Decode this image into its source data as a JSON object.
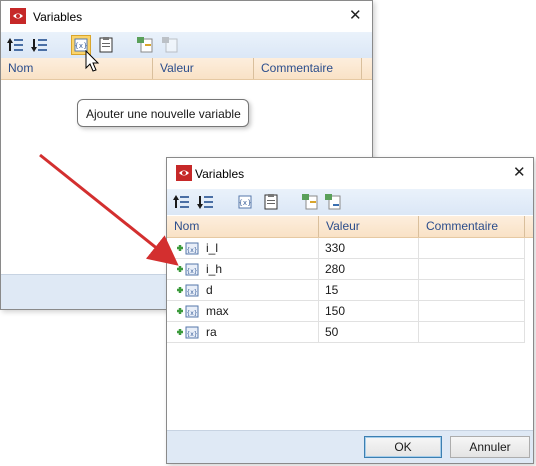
{
  "back_window": {
    "title": "Variables",
    "columns": [
      "Nom",
      "Valeur",
      "Commentaire"
    ]
  },
  "tooltip": {
    "text": "Ajouter une nouvelle variable"
  },
  "front_window": {
    "title": "Variables",
    "columns": [
      "Nom",
      "Valeur",
      "Commentaire"
    ],
    "rows": [
      {
        "name": "i_l",
        "value": "330",
        "comment": ""
      },
      {
        "name": "i_h",
        "value": "280",
        "comment": ""
      },
      {
        "name": "d",
        "value": "15",
        "comment": ""
      },
      {
        "name": "max",
        "value": "150",
        "comment": ""
      },
      {
        "name": "ra",
        "value": "50",
        "comment": ""
      }
    ],
    "ok_label": "OK",
    "cancel_label": "Annuler"
  },
  "toolbar_icons": [
    "move-up-icon",
    "move-down-icon",
    "add-variable-icon",
    "clipboard-icon",
    "import-icon",
    "export-icon"
  ],
  "colors": {
    "accent_arrow": "#d32f2f",
    "header_text": "#2b4d8c",
    "toolbar_bg": "#dfe9f6",
    "header_bg": "#fbe7cf"
  }
}
